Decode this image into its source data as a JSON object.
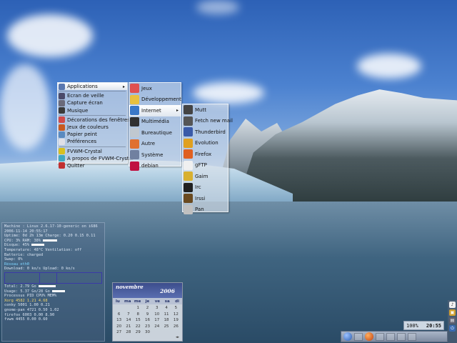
{
  "menu_main": {
    "items": [
      {
        "label": "Applications",
        "icon": "apps-icon",
        "color": "#5a78b0",
        "submenu": true,
        "selected": true
      },
      {
        "label": "Ecran de veille",
        "icon": "screensaver-icon",
        "color": "#4a4a6a"
      },
      {
        "label": "Capture écran",
        "icon": "screenshot-icon",
        "color": "#6a6a7a"
      },
      {
        "label": "Musique",
        "icon": "music-icon",
        "color": "#3a3a3a"
      },
      {
        "label": "Décorations des fenêtres",
        "icon": "window-decor-icon",
        "color": "#d04a4a"
      },
      {
        "label": "Jeux de couleurs",
        "icon": "colors-icon",
        "color": "#c85a20"
      },
      {
        "label": "Papier peint",
        "icon": "wallpaper-icon",
        "color": "#5a8ac0"
      },
      {
        "label": "Préférences",
        "icon": "preferences-icon",
        "color": "#e0e0e8"
      },
      {
        "label": "FVWM-Crystal",
        "icon": "crystal-icon",
        "color": "#d8c020"
      },
      {
        "label": "A propos de FVWM-Crystal",
        "icon": "about-icon",
        "color": "#40a8c0"
      },
      {
        "label": "Quitter",
        "icon": "quit-icon",
        "color": "#c03030"
      }
    ]
  },
  "menu_apps": {
    "items": [
      {
        "label": "Jeux",
        "icon": "games-icon",
        "color": "#e05050"
      },
      {
        "label": "Développement",
        "icon": "development-icon",
        "color": "#e8c040"
      },
      {
        "label": "Internet",
        "icon": "internet-icon",
        "color": "#3a78c8",
        "submenu": true,
        "selected": true
      },
      {
        "label": "Multimédia",
        "icon": "multimedia-icon",
        "color": "#303030"
      },
      {
        "label": "Bureautique",
        "icon": "office-icon",
        "color": "#c0c8d0"
      },
      {
        "label": "Autre",
        "icon": "other-icon",
        "color": "#e07030"
      },
      {
        "label": "Système",
        "icon": "system-icon",
        "color": "#7080a0"
      },
      {
        "label": "debian",
        "icon": "debian-icon",
        "color": "#c01040"
      }
    ]
  },
  "menu_internet": {
    "items": [
      {
        "label": "Mutt",
        "icon": "mutt-icon",
        "color": "#444444"
      },
      {
        "label": "Fetch new mail",
        "icon": "fetch-mail-icon",
        "color": "#555555"
      },
      {
        "label": "Thunderbird",
        "icon": "thunderbird-icon",
        "color": "#3a5aa8"
      },
      {
        "label": "Evolution",
        "icon": "evolution-icon",
        "color": "#e0a020"
      },
      {
        "label": "Firefox",
        "icon": "firefox-icon",
        "color": "#e06020"
      },
      {
        "label": "gFTP",
        "icon": "gftp-icon",
        "color": "#f0f0f0"
      },
      {
        "label": "Gaim",
        "icon": "gaim-icon",
        "color": "#d8b030"
      },
      {
        "label": "Irc",
        "icon": "irc-icon",
        "color": "#202020"
      },
      {
        "label": "Irssi",
        "icon": "irssi-icon",
        "color": "#6a4a20"
      },
      {
        "label": "Pan",
        "icon": "pan-icon",
        "color": "#c0c0c0"
      }
    ]
  },
  "conky": {
    "lines": [
      "Machine : Linux 2.6.17-10-generic on i686",
      "2006-11-14 20:55:17",
      "Uptime: 0d 2h 13m  Charge: 0.20 0.15 0.11",
      "CPU: 3%  RAM: 38%",
      "Disque: 45%",
      "Temperature: 48°C  Ventilation: off",
      "Batterie: charged",
      "Swap: 0%",
      "Réseau eth0",
      "Download: 0 ko/s   Upload: 0 ko/s",
      "Total: 2.79 Go",
      "Usage: 5.37 Go/28 Go",
      "Processus  PID  CPU%  MEM%",
      "Xorg       4582  1.21  4.68",
      "conky      5001  1.00  0.21",
      "gnome-pan  4721  0.50  1.02",
      "firefox    6003  0.00  8.90",
      "fvwm       4455  0.00  0.60"
    ]
  },
  "calendar": {
    "month": "novembre",
    "year": "2006",
    "days_of_week": [
      "lu",
      "ma",
      "me",
      "je",
      "ve",
      "sa",
      "di"
    ],
    "days": [
      "",
      "",
      "1",
      "2",
      "3",
      "4",
      "5",
      "6",
      "7",
      "8",
      "9",
      "10",
      "11",
      "12",
      "13",
      "14",
      "15",
      "16",
      "17",
      "18",
      "19",
      "20",
      "21",
      "22",
      "23",
      "24",
      "25",
      "26",
      "27",
      "28",
      "29",
      "30",
      "",
      "",
      ""
    ]
  },
  "tray": {
    "volume": "100%",
    "time": "20:55"
  },
  "colors": {
    "menu_bg": "#d7dee8",
    "menu_selected": "#ffffff",
    "calendar_header": "#3c4d8c",
    "conky_text": "#d9e4f2"
  }
}
